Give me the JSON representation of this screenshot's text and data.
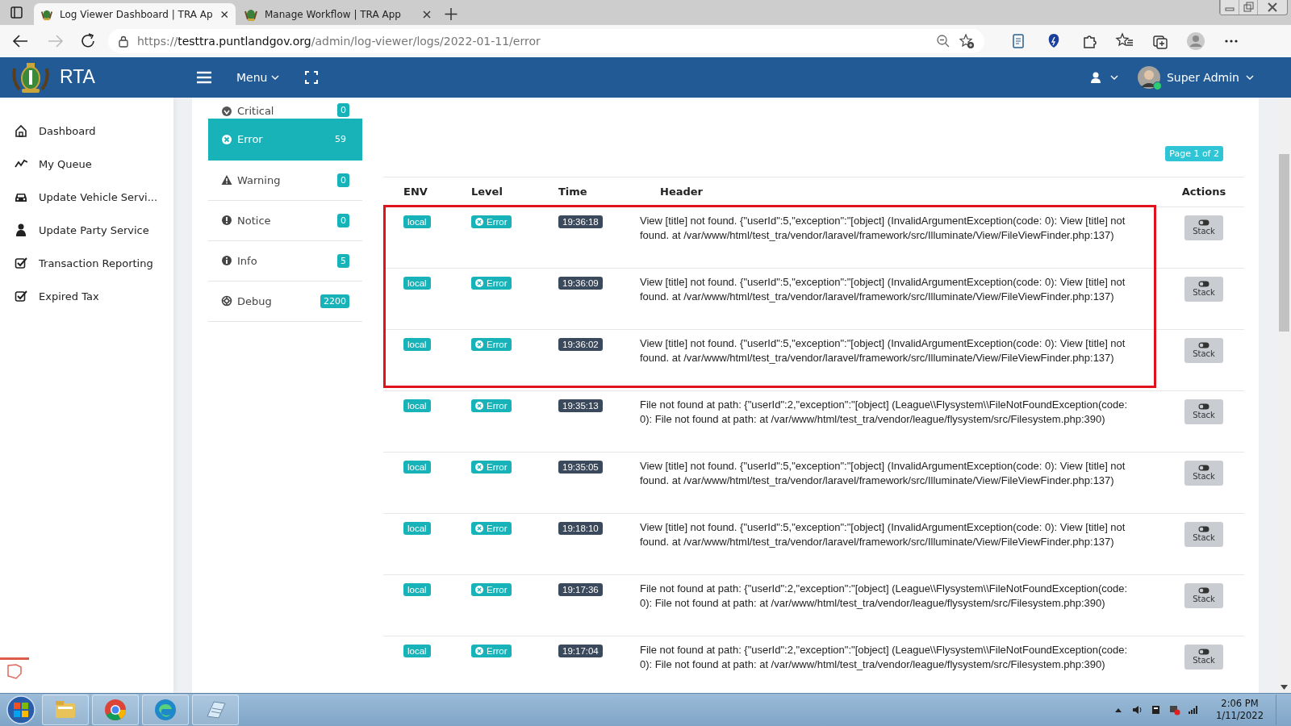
{
  "browser": {
    "tabs": [
      {
        "title": "Log Viewer Dashboard | TRA Ap",
        "selected": true
      },
      {
        "title": "Manage Workflow | TRA App",
        "selected": false
      }
    ],
    "url": {
      "scheme": "https://",
      "host": "testtra.puntlandgov.org",
      "path": "/admin/log-viewer/logs/2022-01-11/error"
    }
  },
  "app_header": {
    "brand": "RTA",
    "menu": "Menu",
    "user": "Super Admin"
  },
  "sidebar": {
    "items": [
      {
        "label": "Dashboard",
        "kind": "home"
      },
      {
        "label": "My Queue",
        "kind": "trend"
      },
      {
        "label": "Update Vehicle Servi...",
        "kind": "car"
      },
      {
        "label": "Update Party Service",
        "kind": "user"
      },
      {
        "label": "Transaction Reporting",
        "kind": "check"
      },
      {
        "label": "Expired Tax",
        "kind": "check"
      }
    ]
  },
  "levels": [
    {
      "label": "Critical",
      "count": "0",
      "kind": "critical",
      "selected": false
    },
    {
      "label": "Error",
      "count": "59",
      "kind": "error",
      "selected": true
    },
    {
      "label": "Warning",
      "count": "0",
      "kind": "warning",
      "selected": false
    },
    {
      "label": "Notice",
      "count": "0",
      "kind": "notice",
      "selected": false
    },
    {
      "label": "Info",
      "count": "5",
      "kind": "info",
      "selected": false
    },
    {
      "label": "Debug",
      "count": "2200",
      "kind": "debug",
      "selected": false
    }
  ],
  "page_badge": "Page 1 of 2",
  "table": {
    "columns": [
      "ENV",
      "Level",
      "Time",
      "Header",
      "Actions"
    ],
    "rows": [
      {
        "env": "local",
        "level": "Error",
        "time": "19:36:18",
        "header": "View [title] not found. {\"userId\":5,\"exception\":\"[object] (InvalidArgumentException(code: 0): View [title] not found. at /var/www/html/test_tra/vendor/laravel/framework/src/Illuminate/View/FileViewFinder.php:137)",
        "action": "Stack",
        "highlighted": true
      },
      {
        "env": "local",
        "level": "Error",
        "time": "19:36:09",
        "header": "View [title] not found. {\"userId\":5,\"exception\":\"[object] (InvalidArgumentException(code: 0): View [title] not found. at /var/www/html/test_tra/vendor/laravel/framework/src/Illuminate/View/FileViewFinder.php:137)",
        "action": "Stack",
        "highlighted": true
      },
      {
        "env": "local",
        "level": "Error",
        "time": "19:36:02",
        "header": "View [title] not found. {\"userId\":5,\"exception\":\"[object] (InvalidArgumentException(code: 0): View [title] not found. at /var/www/html/test_tra/vendor/laravel/framework/src/Illuminate/View/FileViewFinder.php:137)",
        "action": "Stack",
        "highlighted": true
      },
      {
        "env": "local",
        "level": "Error",
        "time": "19:35:13",
        "header": "File not found at path: {\"userId\":2,\"exception\":\"[object] (League\\\\Flysystem\\\\FileNotFoundException(code: 0): File not found at path: at /var/www/html/test_tra/vendor/league/flysystem/src/Filesystem.php:390)",
        "action": "Stack",
        "highlighted": false
      },
      {
        "env": "local",
        "level": "Error",
        "time": "19:35:05",
        "header": "View [title] not found. {\"userId\":5,\"exception\":\"[object] (InvalidArgumentException(code: 0): View [title] not found. at /var/www/html/test_tra/vendor/laravel/framework/src/Illuminate/View/FileViewFinder.php:137)",
        "action": "Stack",
        "highlighted": false
      },
      {
        "env": "local",
        "level": "Error",
        "time": "19:18:10",
        "header": "View [title] not found. {\"userId\":5,\"exception\":\"[object] (InvalidArgumentException(code: 0): View [title] not found. at /var/www/html/test_tra/vendor/laravel/framework/src/Illuminate/View/FileViewFinder.php:137)",
        "action": "Stack",
        "highlighted": false
      },
      {
        "env": "local",
        "level": "Error",
        "time": "19:17:36",
        "header": "File not found at path: {\"userId\":2,\"exception\":\"[object] (League\\\\Flysystem\\\\FileNotFoundException(code: 0): File not found at path: at /var/www/html/test_tra/vendor/league/flysystem/src/Filesystem.php:390)",
        "action": "Stack",
        "highlighted": false
      },
      {
        "env": "local",
        "level": "Error",
        "time": "19:17:04",
        "header": "File not found at path: {\"userId\":2,\"exception\":\"[object] (League\\\\Flysystem\\\\FileNotFoundException(code: 0): File not found at path: at /var/www/html/test_tra/vendor/league/flysystem/src/Filesystem.php:390)",
        "action": "Stack",
        "highlighted": false
      }
    ]
  },
  "taskbar": {
    "time": "2:06 PM",
    "date": "1/11/2022"
  }
}
